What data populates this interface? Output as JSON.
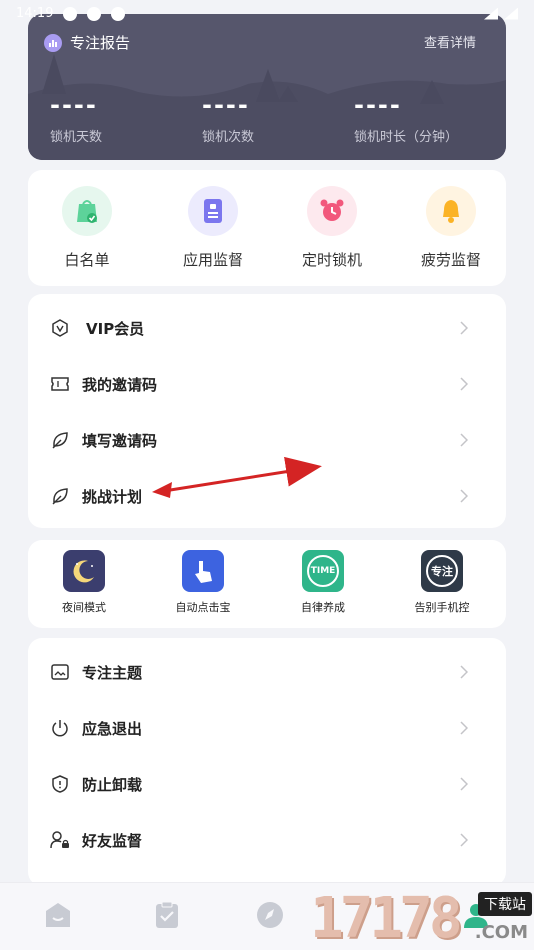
{
  "status_bar": {
    "time": "14:19"
  },
  "report": {
    "title": "专注报告",
    "link": "查看详情",
    "stats": [
      {
        "value": "----",
        "label": "锁机天数"
      },
      {
        "value": "----",
        "label": "锁机次数"
      },
      {
        "value": "----",
        "label": "锁机时长（分钟）"
      }
    ]
  },
  "quick": {
    "items": [
      {
        "label": "白名单",
        "icon": "bag-check-icon",
        "color": "#e6f7ee"
      },
      {
        "label": "应用监督",
        "icon": "app-monitor-icon",
        "color": "#ecebfd"
      },
      {
        "label": "定时锁机",
        "icon": "alarm-clock-icon",
        "color": "#fde9ee"
      },
      {
        "label": "疲劳监督",
        "icon": "bell-icon",
        "color": "#fff4e1"
      }
    ]
  },
  "menu1": {
    "items": [
      {
        "label": "VIP会员",
        "icon": "vip-icon"
      },
      {
        "label": "我的邀请码",
        "icon": "ticket-icon"
      },
      {
        "label": "填写邀请码",
        "icon": "leaf-icon"
      },
      {
        "label": "挑战计划",
        "icon": "leaf-icon"
      }
    ]
  },
  "tools": {
    "items": [
      {
        "label": "夜间模式",
        "icon": "moon-icon",
        "color": "#3b3e6e"
      },
      {
        "label": "自动点击宝",
        "icon": "tap-hand-icon",
        "color": "#3d63e0"
      },
      {
        "label": "自律养成",
        "icon": "time-icon",
        "color": "#2fb58a",
        "text": "TIME"
      },
      {
        "label": "告别手机控",
        "icon": "focus-icon",
        "color": "#2f3a48",
        "text": "专注"
      }
    ]
  },
  "menu2": {
    "items": [
      {
        "label": "专注主题",
        "icon": "image-icon"
      },
      {
        "label": "应急退出",
        "icon": "power-icon"
      },
      {
        "label": "防止卸载",
        "icon": "shield-icon"
      },
      {
        "label": "好友监督",
        "icon": "user-lock-icon"
      }
    ]
  },
  "watermark": {
    "digits": "17178",
    "tag": "下载站",
    "com": ".COM"
  }
}
